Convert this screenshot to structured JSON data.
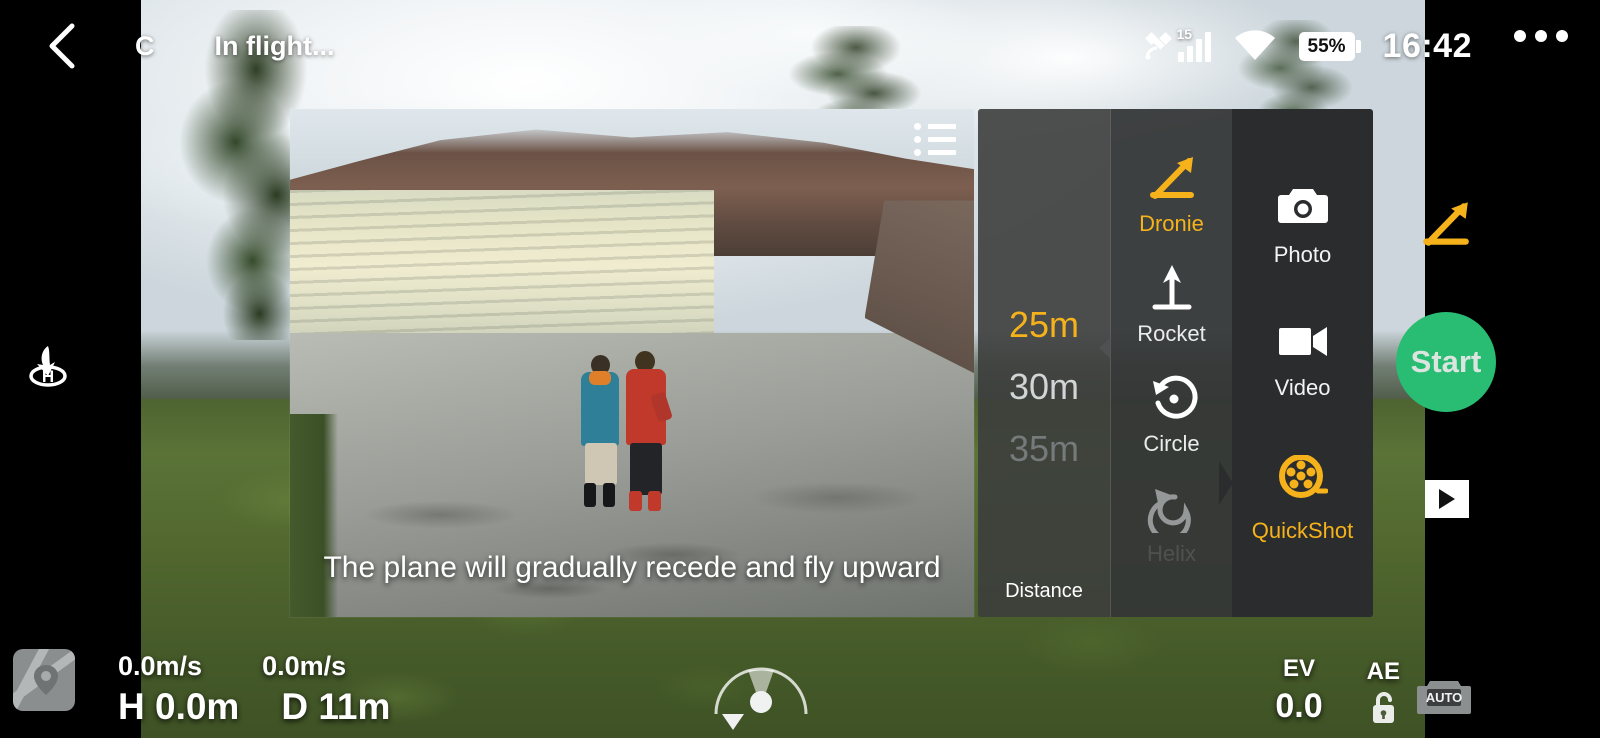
{
  "topbar": {
    "back_icon": "chevron-left-icon",
    "drone_letter": "C",
    "flight_status": "In flight...",
    "satellite_icon": "satellite-icon",
    "gps_satellite_count": "15",
    "signal_icon": "signal-bars-icon",
    "wifi_icon": "wifi-icon",
    "battery_percent": "55%",
    "battery_icon": "battery-icon",
    "clock": "16:42",
    "more_icon": "more-horizontal-icon"
  },
  "left_rail": {
    "rth_icon": "return-to-home-icon",
    "map_icon": "map-pin-icon"
  },
  "tutorial_video": {
    "list_icon": "bulleted-list-icon",
    "caption": "The plane will gradually recede and fly upward"
  },
  "quickshot_panel": {
    "distance": {
      "label": "Distance",
      "options": [
        {
          "value": "25m",
          "state": "selected"
        },
        {
          "value": "30m",
          "state": "near"
        },
        {
          "value": "35m",
          "state": "far"
        }
      ],
      "selected": "25m"
    },
    "modes": [
      {
        "label": "Dronie",
        "icon": "dronie-arrow-icon",
        "selected": true
      },
      {
        "label": "Rocket",
        "icon": "rocket-up-arrow-icon",
        "selected": false
      },
      {
        "label": "Circle",
        "icon": "circle-orbit-icon",
        "selected": false
      },
      {
        "label": "Helix",
        "icon": "helix-spiral-icon",
        "selected": false
      }
    ],
    "tabs": [
      {
        "label": "Photo",
        "icon": "camera-icon",
        "selected": false
      },
      {
        "label": "Video",
        "icon": "camcorder-icon",
        "selected": false
      },
      {
        "label": "QuickShot",
        "icon": "film-reel-icon",
        "selected": true
      }
    ]
  },
  "right_rail": {
    "active_mode_icon": "dronie-arrow-icon",
    "start_label": "Start",
    "playback_icon": "play-icon"
  },
  "hud": {
    "vertical_speed": "0.0m/s",
    "horizontal_speed": "0.0m/s",
    "height": "H 0.0m",
    "distance": "D 11m",
    "radar_icon": "radar-attitude-icon",
    "ev_label": "EV",
    "ev_value": "0.0",
    "ae_label": "AE",
    "ae_icon": "unlock-icon",
    "auto_badge": "AUTO"
  },
  "colors": {
    "accent_yellow": "#f5b21b",
    "start_green": "#28bd72",
    "panel_dark": "#2b2c2d",
    "text_white": "#ffffff"
  }
}
